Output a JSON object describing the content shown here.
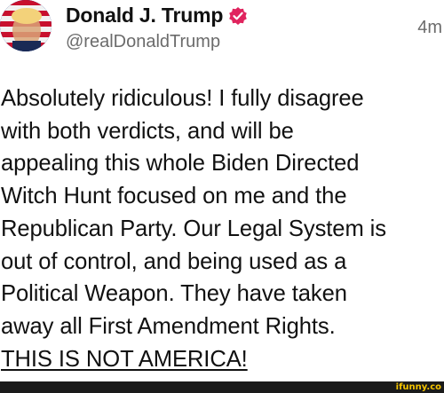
{
  "post": {
    "author": {
      "display_name": "Donald J. Trump",
      "handle": "@realDonaldTrump",
      "verified": true,
      "avatar_icon": "profile-avatar"
    },
    "timestamp": "4m",
    "body_lines": [
      "Absolutely ridiculous! I fully disagree",
      "with both verdicts, and will be",
      "appealing this whole Biden Directed",
      "Witch Hunt focused on me and the",
      "Republican Party. Our Legal System is",
      "out of control, and being used as a",
      "Political Weapon. They have taken",
      "away all First Amendment Rights.",
      "THIS IS NOT AMERICA!"
    ]
  },
  "watermark": {
    "text": "ifunny.co",
    "color": "#f5c400"
  },
  "colors": {
    "text": "#111111",
    "secondary_text": "#6b6b6b",
    "verified_badge": "#e0245e",
    "background": "#ffffff"
  }
}
